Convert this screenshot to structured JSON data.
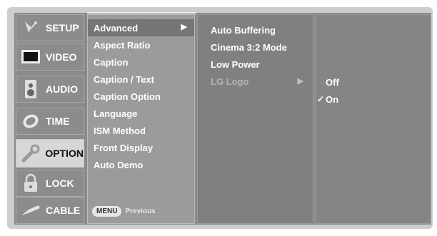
{
  "sidebar": {
    "items": [
      {
        "label": "SETUP",
        "icon": "satellite-icon",
        "selected": false
      },
      {
        "label": "VIDEO",
        "icon": "screen-icon",
        "selected": false
      },
      {
        "label": "AUDIO",
        "icon": "speaker-icon",
        "selected": false
      },
      {
        "label": "TIME",
        "icon": "clock-icon",
        "selected": false
      },
      {
        "label": "OPTION",
        "icon": "wrench-icon",
        "selected": true
      },
      {
        "label": "LOCK",
        "icon": "padlock-icon",
        "selected": false
      },
      {
        "label": "CABLE",
        "icon": "cable-icon",
        "selected": false
      }
    ]
  },
  "submenu": {
    "items": [
      {
        "label": "Advanced",
        "selected": true,
        "has_arrow": true
      },
      {
        "label": "Aspect Ratio"
      },
      {
        "label": "Caption"
      },
      {
        "label": "Caption / Text"
      },
      {
        "label": "Caption Option"
      },
      {
        "label": "Language"
      },
      {
        "label": "ISM Method"
      },
      {
        "label": "Front Display"
      },
      {
        "label": "Auto Demo"
      }
    ],
    "menu_button": "MENU",
    "menu_previous": "Previous"
  },
  "advanced": {
    "items": [
      {
        "label": "Auto Buffering"
      },
      {
        "label": "Cinema 3:2 Mode"
      },
      {
        "label": "Low Power"
      },
      {
        "label": "LG Logo",
        "disabled": true,
        "has_arrow": true
      }
    ]
  },
  "options": {
    "items": [
      {
        "label": "Off",
        "checked": false
      },
      {
        "label": "On",
        "checked": true
      }
    ]
  },
  "glyphs": {
    "arrow": "▶",
    "check": "✓"
  },
  "colors": {
    "panel": "#8a8a8a",
    "selected_side": "#d7d7d7",
    "selected_sub": "#757575"
  }
}
